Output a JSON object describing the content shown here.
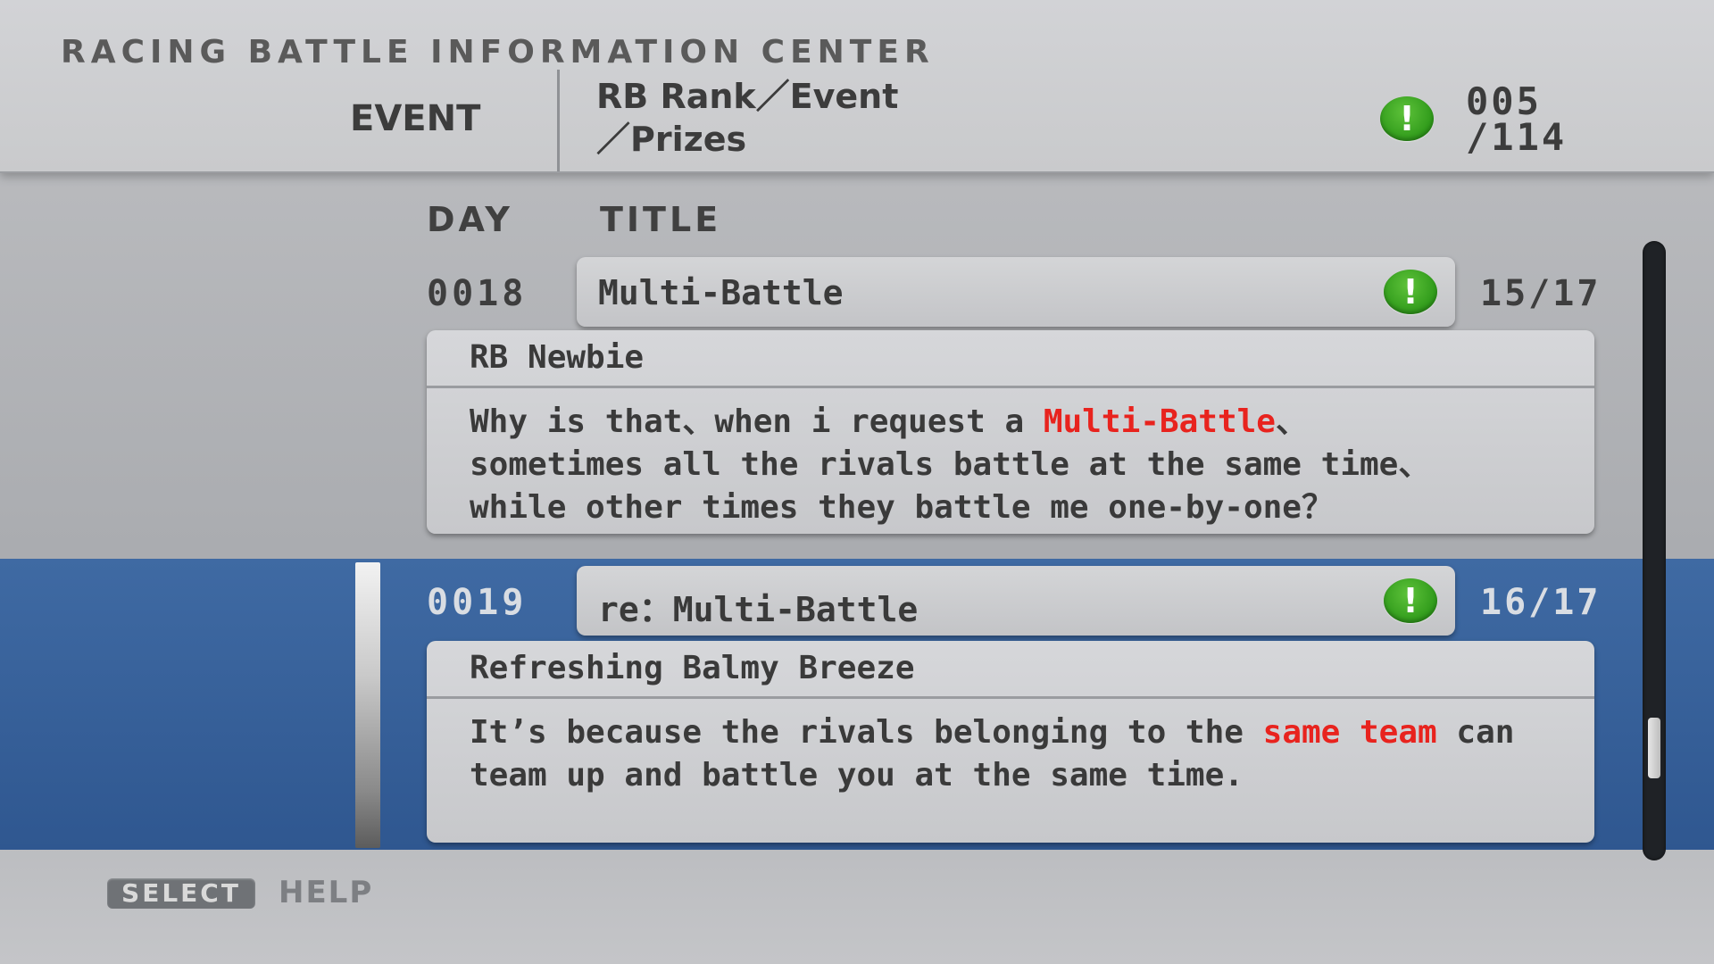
{
  "header": {
    "app_title": "RACING BATTLE  INFORMATION CENTER",
    "section_tab": "EVENT",
    "breadcrumb_line1": "RB Rank／Event",
    "breadcrumb_line2": "／Prizes",
    "counter_current": "005",
    "counter_total": "/114",
    "counter_icon": "exclamation-icon"
  },
  "columns": {
    "day": "DAY",
    "title": "TITLE"
  },
  "posts": [
    {
      "day": "0018",
      "title": "Multi-Battle",
      "count": "15/17",
      "author": "RB Newbie",
      "body_parts": [
        {
          "text": "Why is that、when i request a ",
          "highlight": false
        },
        {
          "text": "Multi-Battle",
          "highlight": true
        },
        {
          "text": "、\nsometimes all the rivals battle at the same time、\nwhile other times they battle me one-by-one？",
          "highlight": false
        }
      ],
      "selected": false
    },
    {
      "day": "0019",
      "title": "re：Multi-Battle",
      "count": "16/17",
      "author": "Refreshing Balmy Breeze",
      "body_parts": [
        {
          "text": "It’s because the rivals belonging to the ",
          "highlight": false
        },
        {
          "text": "same team",
          "highlight": true
        },
        {
          "text": " can\nteam up and battle you at the same time.",
          "highlight": false
        }
      ],
      "selected": true
    }
  ],
  "scrollbar": {
    "thumb_position_fraction": 0.86,
    "thumb_size_fraction": 0.1
  },
  "footer": {
    "select_button": "SELECT",
    "help_label": "HELP"
  },
  "colors": {
    "highlight": "#e8231e",
    "selection": "#3a639c",
    "alert_green": "#36a31f"
  }
}
